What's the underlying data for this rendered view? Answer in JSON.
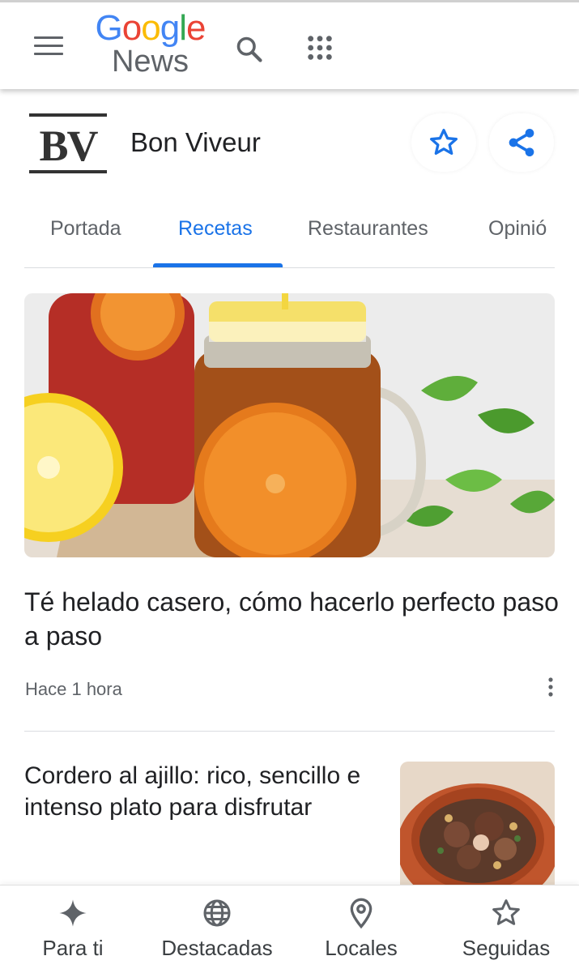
{
  "app": {
    "logo_google": "Google",
    "logo_news": "News"
  },
  "header_icons": {
    "menu": "menu-icon",
    "search": "search-icon",
    "apps": "apps-grid-icon"
  },
  "publisher": {
    "logo_text": "BV",
    "name": "Bon Viveur",
    "follow_icon": "star-icon",
    "share_icon": "share-icon"
  },
  "tabs": [
    {
      "label": "Portada",
      "active": false
    },
    {
      "label": "Recetas",
      "active": true
    },
    {
      "label": "Restaurantes",
      "active": false
    },
    {
      "label": "Opinió",
      "active": false
    }
  ],
  "articles": [
    {
      "headline": "Té helado casero, cómo hacerlo perfecto paso a paso",
      "time": "Hace 1 hora"
    },
    {
      "headline": "Cordero al ajillo: rico, sencillo e intenso plato para disfrutar"
    }
  ],
  "bottom_nav": [
    {
      "label": "Para ti",
      "icon": "for-you-diamond-icon"
    },
    {
      "label": "Destacadas",
      "icon": "globe-icon"
    },
    {
      "label": "Locales",
      "icon": "location-pin-icon"
    },
    {
      "label": "Seguidas",
      "icon": "star-outline-icon"
    }
  ],
  "colors": {
    "accent": "#1a73e8",
    "text": "#202124",
    "secondary": "#5f6368"
  }
}
